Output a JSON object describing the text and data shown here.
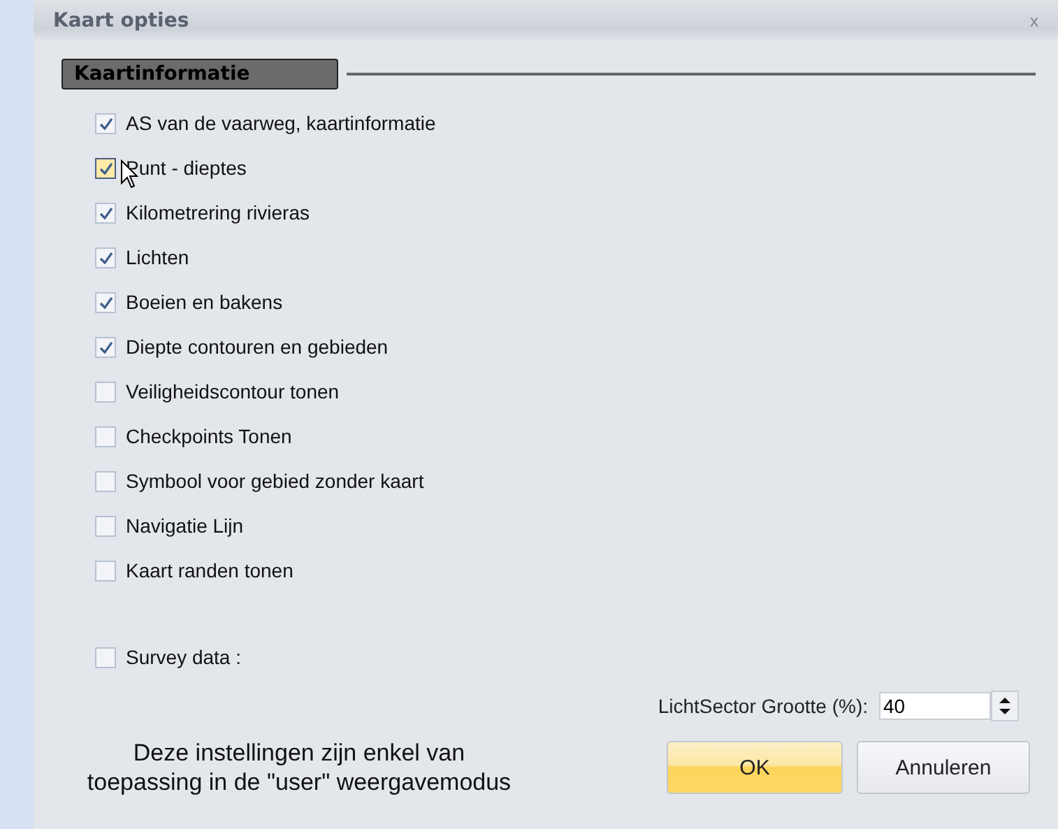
{
  "window": {
    "title": "Kaart opties",
    "close": "x"
  },
  "section": {
    "title": "Kaartinformatie"
  },
  "options": [
    {
      "label": "AS van de vaarweg, kaartinformatie",
      "checked": true,
      "hovered": false
    },
    {
      "label": "Punt - dieptes",
      "checked": true,
      "hovered": true
    },
    {
      "label": "Kilometrering rivieras",
      "checked": true,
      "hovered": false
    },
    {
      "label": "Lichten",
      "checked": true,
      "hovered": false
    },
    {
      "label": "Boeien en bakens",
      "checked": true,
      "hovered": false
    },
    {
      "label": "Diepte contouren en gebieden",
      "checked": true,
      "hovered": false
    },
    {
      "label": "Veiligheidscontour tonen",
      "checked": false,
      "hovered": false
    },
    {
      "label": "Checkpoints Tonen",
      "checked": false,
      "hovered": false
    },
    {
      "label": "Symbool voor gebied zonder kaart",
      "checked": false,
      "hovered": false
    },
    {
      "label": "Navigatie Lijn",
      "checked": false,
      "hovered": false
    },
    {
      "label": "Kaart randen tonen",
      "checked": false,
      "hovered": false
    }
  ],
  "survey": {
    "label": "Survey data :",
    "checked": false,
    "hovered": false
  },
  "sector_size": {
    "label": "LichtSector Grootte (%):",
    "value": "40"
  },
  "note": "Deze instellingen zijn enkel van toepassing in de \"user\" weergavemodus",
  "buttons": [
    {
      "label": "OK",
      "default": true
    },
    {
      "label": "Annuleren",
      "default": false
    }
  ]
}
